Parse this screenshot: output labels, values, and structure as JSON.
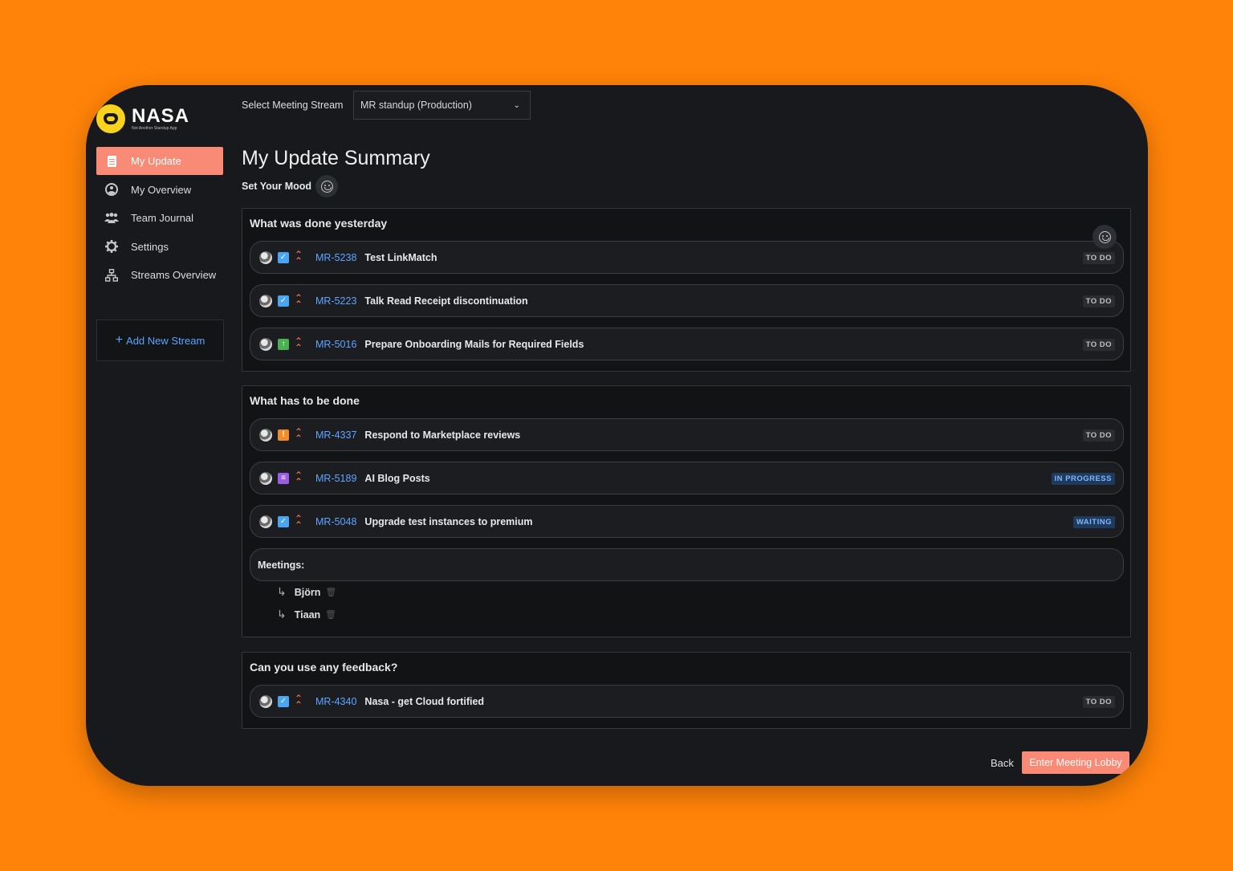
{
  "app": {
    "logo_name": "NASA",
    "logo_tagline": "Not Another Standup App"
  },
  "sidebar": {
    "items": [
      {
        "label": "My Update",
        "icon": "document-icon",
        "active": true
      },
      {
        "label": "My Overview",
        "icon": "user-circle-icon",
        "active": false
      },
      {
        "label": "Team Journal",
        "icon": "team-icon",
        "active": false
      },
      {
        "label": "Settings",
        "icon": "gear-icon",
        "active": false
      },
      {
        "label": "Streams Overview",
        "icon": "hierarchy-icon",
        "active": false
      }
    ],
    "add_stream_label": "Add New Stream"
  },
  "header": {
    "stream_label": "Select Meeting Stream",
    "stream_value": "MR standup (Production)"
  },
  "main": {
    "title": "My Update Summary",
    "mood_label": "Set Your Mood",
    "sections": [
      {
        "title": "What was done yesterday",
        "tasks": [
          {
            "type": "task",
            "key": "MR-5238",
            "summary": "Test LinkMatch",
            "status": "TO DO"
          },
          {
            "type": "task",
            "key": "MR-5223",
            "summary": "Talk Read Receipt discontinuation",
            "status": "TO DO"
          },
          {
            "type": "improvement",
            "key": "MR-5016",
            "summary": "Prepare Onboarding Mails for Required Fields",
            "status": "TO DO"
          }
        ]
      },
      {
        "title": "What has to be done",
        "tasks": [
          {
            "type": "bug",
            "key": "MR-4337",
            "summary": "Respond to Marketplace reviews",
            "status": "TO DO"
          },
          {
            "type": "story",
            "key": "MR-5189",
            "summary": "AI Blog Posts",
            "status": "IN PROGRESS"
          },
          {
            "type": "task",
            "key": "MR-5048",
            "summary": "Upgrade test instances to premium",
            "status": "WAITING"
          }
        ],
        "meetings_label": "Meetings:",
        "meetings": [
          "Björn",
          "Tiaan"
        ]
      },
      {
        "title": "Can you use any feedback?",
        "tasks": [
          {
            "type": "task",
            "key": "MR-4340",
            "summary": "Nasa - get Cloud fortified",
            "status": "TO DO"
          }
        ]
      }
    ]
  },
  "footer": {
    "back_label": "Back",
    "enter_label": "Enter Meeting Lobby"
  },
  "colors": {
    "accent": "#f98a75",
    "link": "#5ea6ff",
    "background": "#ff8308"
  }
}
